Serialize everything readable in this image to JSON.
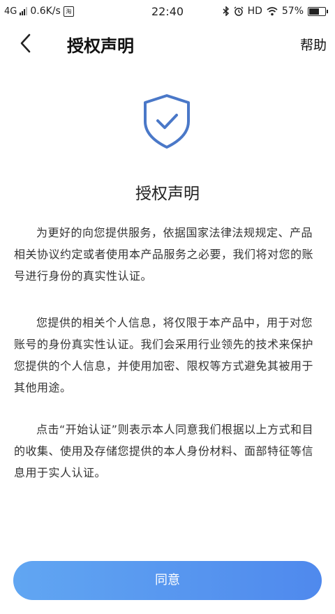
{
  "status_bar": {
    "network": "4G",
    "speed": "0.6K/s",
    "app_glyph": "淘",
    "time": "22:40",
    "hd": "HD",
    "battery_percent": "57%",
    "battery_level": 0.57
  },
  "nav": {
    "title": "授权声明",
    "help_label": "帮助",
    "back_icon": "chevron-left-icon"
  },
  "content": {
    "shield_icon": "shield-check-icon",
    "heading": "授权声明",
    "paragraphs": [
      "为更好的向您提供服务，依据国家法律法规规定、产品相关协议约定或者使用本产品服务之必要，我们将对您的账号进行身份的真实性认证。",
      "您提供的相关个人信息，将仅限于本产品中，用于对您账号的身份真实性认证。我们会采用行业领先的技术来保护您提供的个人信息，并使用加密、限权等方式避免其被用于其他用途。",
      "点击“开始认证”则表示本人同意我们根据以上方式和目的收集、使用及存储您提供的本人身份材料、面部特征等信息用于实人认证。"
    ]
  },
  "agree_button": {
    "label": "同意"
  },
  "colors": {
    "accent": "#4f89ed",
    "shield": "#4a78c8",
    "text": "#333333"
  }
}
